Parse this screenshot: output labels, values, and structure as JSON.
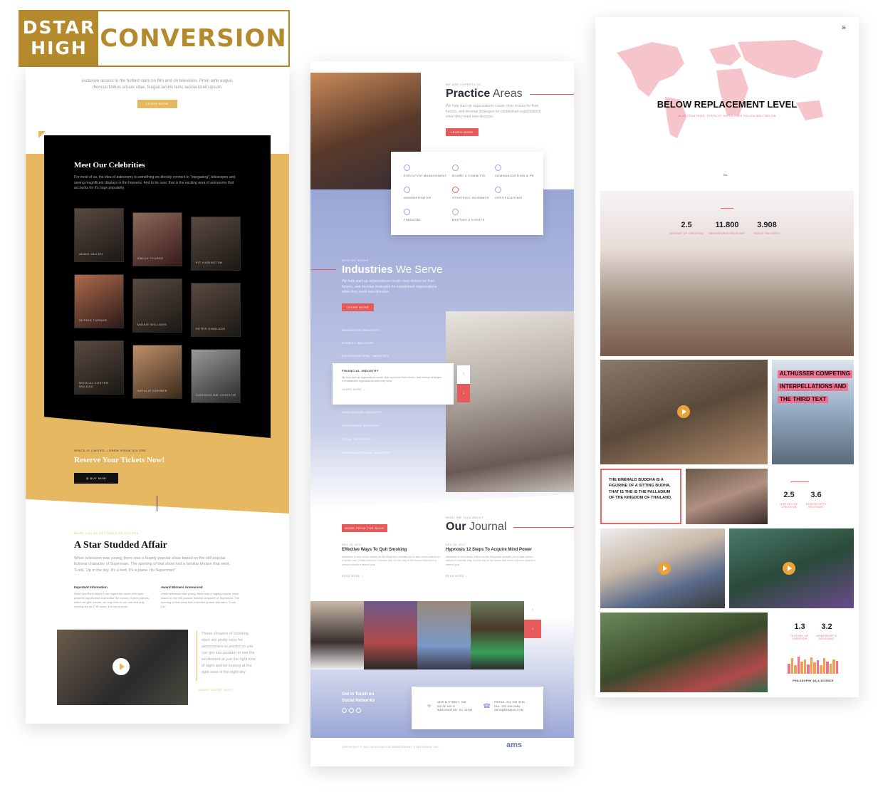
{
  "logo": {
    "left_line1": "DSTAR",
    "left_line2": "HIGH",
    "right": "CONVERSION"
  },
  "celebs": {
    "intro_line1": "exclusive access to the hottest stars on film and on television. Proin ante augue,",
    "intro_line2": "rhoncus finibus ornare vitae, feugiat iaculis nunc lacinia lorem ipsum.",
    "learn_more": "LEARN MORE",
    "title": "Meet Our Celebrities",
    "desc": "For most of us, the idea of astronomy is something we directly connect to \"stargazing\", telescopes and seeing magnificent displays in the heavens. And to be sure, that is the exciting area of astronomy that accounts for it's huge popularity.",
    "people": [
      "AIDAN GILLEN",
      "EMILIA CLARKE",
      "KIT HARINGTON",
      "SOPHIE TURNER",
      "MAISIE WILLIAMS",
      "PETER DINKLAGE",
      "NIKOLAJ COSTER WALDAU",
      "NATALIE DORMER",
      "GWENDOLINE CHRISTIE"
    ],
    "space_limited": "SPACE IS LIMITED. LOREM IPSUM DOLORE.",
    "reserve": "Reserve Your Tickets Now!",
    "buy_now": "BUY NOW",
    "kicker": "MORE YOU BE GETTING A TELESCOPE",
    "affair_title": "A Star Studded Affair",
    "affair_text": "When television was young, there was a hugely popular show based on the still popular fictional character of Superman. The opening of that show had a familiar phrase that went, \"Look. Up in the sky. It's a bird. It's a plane. It's Superman!\"",
    "col1_title": "Important Information",
    "col1_text": "When you think about it, we regard the moon with such powerful significance that unlike the moons of other planets which we give names, we only refer to our one and only orbiting orb as THE moon. It is not a moon.",
    "col2_title": "Award Winners Announced",
    "col2_text": "When television was young, there was a hugely popular show based on the still popular fictional character of Superman. The opening of that show had a familiar phrase that went, \"Look. Up.\"",
    "quote": "These showers of shooting stars are pretty easy for astronomers to predict so you can get into position to see the excitement at just the right time of night and be looking at the right area of the night sky.",
    "quote_author": "MARIO LOPEZ, HOST"
  },
  "ams": {
    "experts_label": "WE ARE EXPERTS IN",
    "practice_bold": "Practice",
    "practice_light": "Areas",
    "practice_text": "We help start-up organizations create clear visions for their futures, and develop strategies for established organizations when they need new direction.",
    "learn_more": "LEARN MORE",
    "areas": [
      "EXECUTIVE MANAGEMENT",
      "BOARD & COMMITTE",
      "COMMUNICATIONS & PR",
      "ADMINISTRATIVE",
      "STRATEGIC GUIDANCE",
      "CERTIFICATIONS",
      "FINANCIAL",
      "MEETING & EVENTS"
    ],
    "serve_label": "WHO WE SERVE",
    "industries_bold": "Industries",
    "industries_light": "We Serve",
    "industries_text": "We help start-up organizations create clear visions for their futures, and develop strategies for established organizations when they need new direction.",
    "industries_top": [
      "EDUCATION INDUSTRY",
      "ENERGY INDUSTRY",
      "ENVIRONMENTAL INDUSTRY"
    ],
    "financial_title": "FINANCIAL INDUSTRY",
    "financial_text": "We help start-up organizations create clear visions for their futures, and develop strategies for established organizations when they need.",
    "financial_link": "LEARN MORE",
    "industries_bottom": [
      "HEALTHCARE INDUSTRY",
      "INSURANCE INDUSTRY",
      "LEGAL INDUSTRY",
      "PHARMACEUTICAL INDUSTRY"
    ],
    "journal_label": "WHAT WE TALK ABOUT",
    "journal_bold": "Our",
    "journal_light": "Journal",
    "blog_btn": "MORE FROM THE BLOG",
    "post1_date": "DEC 18, 2017",
    "post1_title": "Effective Ways To Quit Smoking",
    "post1_text": "Motivation is very simply defined as the things that motivate you to take certain actions in a certain way. Certain actions in a certain way. It is the why or the reason that drives a person towards a desired goal.",
    "post2_date": "DEC 18, 2017",
    "post2_title": "Hypnosis 12 Steps To Acquire Mind Power",
    "post2_text": "Motivation is very simply defined as the things that motivate you to take certain actions in a certain way. It is the why or the reason that drives a person towards a desired goal.",
    "read_more": "READ MORE",
    "social_line1": "Get in Touch on",
    "social_line2": "Social Networks",
    "address1": "1800 M STREET, NW",
    "address2": "SUITE 400 S",
    "address3": "WASHINGTON, DC 20036",
    "phone": "PHONE: 202.590.3391",
    "fax": "FAX: 202.530.0659",
    "email": "INFO@DOMAIN.COM",
    "copyright": "COPYRIGHT © 2017 ASSOCIATION MANAGEMENT STRATEGIES, INC.",
    "brand": "ams"
  },
  "demo": {
    "title": "BELOW REPLACEMENT LEVEL",
    "subtitle": "IN 83 COUNTRIES, FERTILITY RATES HAVE FALLEN WELL BELOW",
    "down_label": "BA",
    "stats1": [
      {
        "num": "2.5",
        "label": "HISTORY OF CREATION"
      },
      {
        "num": "11.800",
        "label": "HEMOSFORTS RELEVANT"
      },
      {
        "num": "3.908",
        "label": "PEACE ON EARTH"
      }
    ],
    "highlight1": "ALTHUSSER COMPETING",
    "highlight2": "INTERPELLATIONS AND",
    "highlight3": "THE THIRD TEXT",
    "quote": "THE EMERALD BUDDHA IS A FIGURINE OF A SITTING BUDHA, THAT IS THE IS THE PALLADIUM OF THE KINGDOM OF THAILAND.",
    "stats2": [
      {
        "num": "2.5",
        "label": "HISTORY OF CREATION"
      },
      {
        "num": "3.6",
        "label": "HEMOSFORTS RELEVANT"
      }
    ],
    "stats3": [
      {
        "num": "1.3",
        "label": "HISTORY OF CREATION"
      },
      {
        "num": "3.2",
        "label": "HEMOSFORTS RELEVANT"
      }
    ],
    "bars_values": [
      0.6,
      0.9,
      0.5,
      1.0,
      0.7,
      0.85,
      0.55,
      0.95,
      0.65,
      0.8,
      0.5,
      0.9,
      0.7,
      0.6,
      0.85,
      0.75
    ],
    "philosophy": "PHILOSOPHY AS A SCIENCE"
  },
  "colors": {
    "gold": "#e5b861",
    "accent_red": "#e65a5a",
    "ams_blue": "#9aa6d6",
    "pink": "#f07090"
  }
}
